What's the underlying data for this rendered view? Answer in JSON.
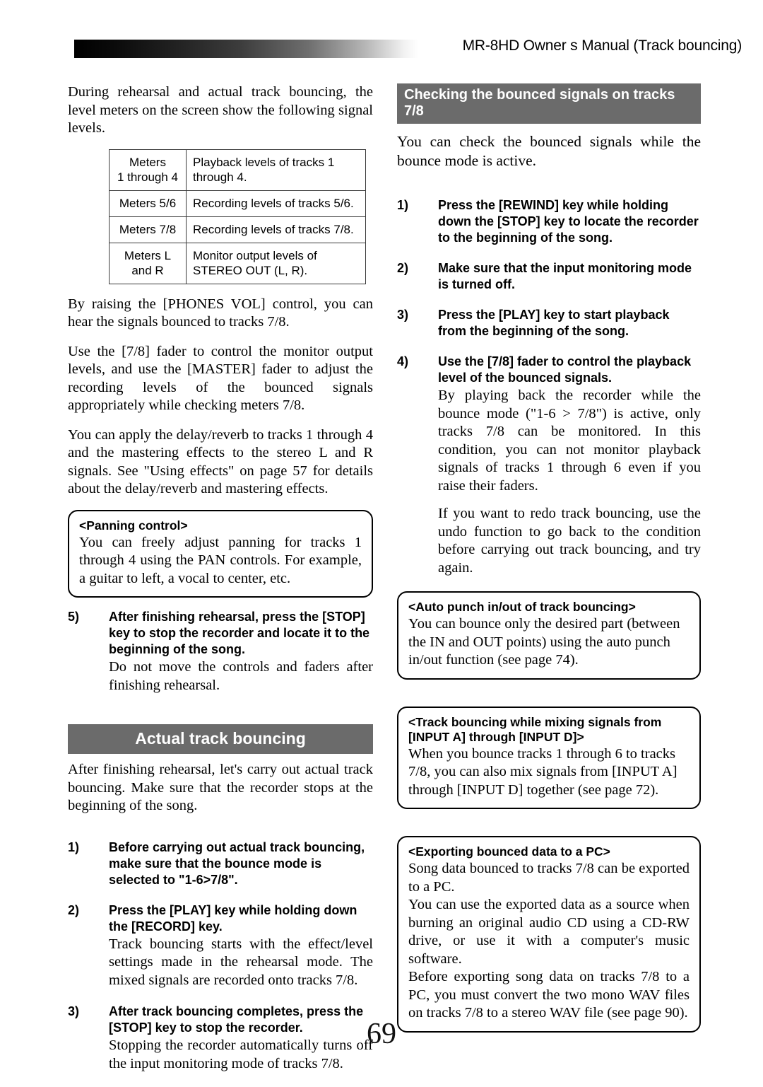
{
  "header": {
    "title": "MR-8HD Owner s Manual (Track bouncing)"
  },
  "page_number": "69",
  "left_column": {
    "intro_paragraph": "During rehearsal and actual track bouncing, the level meters on the screen show the following signal levels.",
    "meter_table": {
      "rows": [
        {
          "meter": "Meters\n1 through 4",
          "description": "Playback levels of tracks 1 through 4."
        },
        {
          "meter": "Meters 5/6",
          "description": "Recording levels of tracks 5/6."
        },
        {
          "meter": "Meters 7/8",
          "description": "Recording levels of tracks 7/8."
        },
        {
          "meter": "Meters L\nand R",
          "description": "Monitor output levels of STEREO OUT (L, R)."
        }
      ]
    },
    "paragraph_phones": "By raising the [PHONES VOL] control, you can hear the signals bounced to tracks 7/8.",
    "paragraph_fader": "Use the [7/8] fader to control the monitor output levels, and use the [MASTER] fader to adjust the recording levels of the bounced signals appropriately while checking meters 7/8.",
    "paragraph_effects": "You can apply the delay/reverb to tracks 1 through 4 and the mastering effects to the stereo L and R signals. See \"Using effects\" on page 57 for details about the delay/reverb and mastering effects.",
    "panning_note": {
      "title": "<Panning control>",
      "body": "You can freely adjust panning for tracks 1 through 4 using the PAN controls. For example, a guitar to left, a vocal to center, etc."
    },
    "step5": {
      "number": "5)",
      "head": "After finishing rehearsal, press the [STOP] key to stop the recorder and locate it to the beginning of the song.",
      "desc": "Do not move the controls and faders after finishing rehearsal."
    },
    "actual_section": {
      "heading": "Actual track bouncing",
      "intro": "After finishing rehearsal, let's carry out actual track bouncing. Make sure that the recorder stops at the beginning of the song.",
      "steps": [
        {
          "number": "1)",
          "head": "Before carrying out actual track bouncing, make sure that the bounce mode is selected to \"1-6>7/8\".",
          "desc": ""
        },
        {
          "number": "2)",
          "head": "Press the [PLAY] key while holding down the [RECORD] key.",
          "desc": "Track bouncing starts with the effect/level settings made in the rehearsal mode. The mixed signals are recorded onto tracks 7/8."
        },
        {
          "number": "3)",
          "head": "After track bouncing completes, press the [STOP] key to stop the recorder.",
          "desc": "Stopping the recorder automatically turns off the input monitoring mode of tracks 7/8."
        }
      ]
    }
  },
  "right_column": {
    "section_heading": "Checking the bounced signals on tracks 7/8",
    "intro": "You can check the bounced signals while the bounce mode is active.",
    "steps": [
      {
        "number": "1)",
        "head": "Press the [REWIND] key while holding down the [STOP] key to locate the recorder to the beginning of the song.",
        "desc": "",
        "desc2": ""
      },
      {
        "number": "2)",
        "head": "Make sure that the input monitoring mode is turned off.",
        "desc": "",
        "desc2": ""
      },
      {
        "number": "3)",
        "head": "Press the [PLAY] key to start playback from the beginning of the song.",
        "desc": "",
        "desc2": ""
      },
      {
        "number": "4)",
        "head": "Use the [7/8] fader to control the playback level of the bounced signals.",
        "desc": "By playing back the recorder while the bounce mode (\"1-6 > 7/8\") is active, only tracks 7/8 can be monitored. In this condition, you can not monitor playback signals of tracks 1 through 6 even if you raise their faders.",
        "desc2": "If you want to redo track bouncing, use the undo function to go back to the condition before carrying out track bouncing, and try again."
      }
    ],
    "notes": [
      {
        "title": "<Auto punch in/out of track bouncing>",
        "body": "You can bounce only the desired part (between the IN and OUT points) using the auto punch in/out function (see page 74)."
      },
      {
        "title": "<Track bouncing while mixing signals from [INPUT A] through [INPUT D]>",
        "body": "When you bounce tracks 1 through 6 to tracks 7/8, you can also mix signals from [INPUT A] through [INPUT D] together (see page 72)."
      },
      {
        "title": "<Exporting bounced data to a PC>",
        "body": "Song data bounced to tracks 7/8 can be exported to a PC.\nYou can use the exported data as a source when burning an original audio CD using a CD-RW drive, or use it with a computer's music software.\nBefore exporting song data on tracks 7/8 to a PC, you must convert the two mono WAV files on tracks 7/8 to a stereo WAV file (see page 90)."
      }
    ]
  }
}
